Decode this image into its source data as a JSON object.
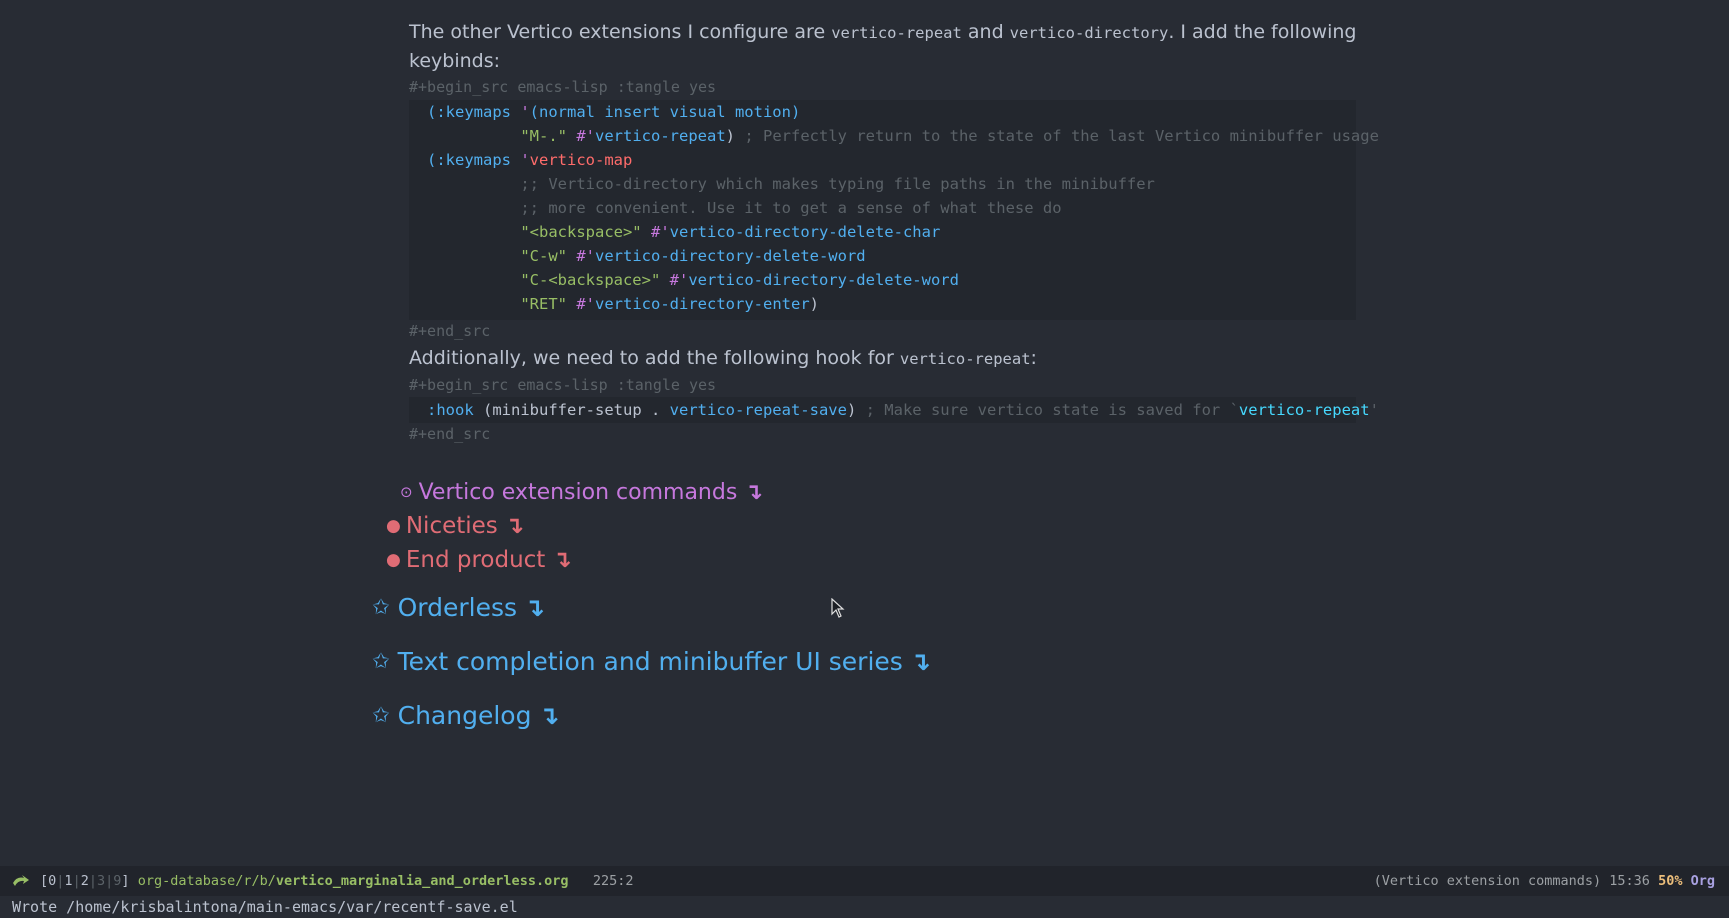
{
  "paragraph1": {
    "t1": "The other Vertico extensions I configure are ",
    "c1": "vertico-repeat",
    "t2": " and ",
    "c2": "vertico-directory",
    "t3": ". I add the following",
    "line2": "keybinds:"
  },
  "src1": {
    "begin": "#+begin_src emacs-lisp :tangle yes",
    "end": "#+end_src",
    "lines": [
      {
        "a": "(:keymaps ",
        "b": "'",
        "c": "(normal insert visual motion)"
      },
      {
        "indent": "          ",
        "str": "\"M-.\"",
        "sp": " ",
        "q": "#'",
        "fn": "vertico-repeat",
        "close": ")",
        "cmt": " ; Perfectly return to the state of the last Vertico minibuffer usage"
      },
      {
        "a": "(:keymaps ",
        "b": "'",
        "sym": "vertico-map"
      },
      {
        "indent": "          ",
        "cmt": ";; Vertico-directory which makes typing file paths in the minibuffer"
      },
      {
        "indent": "          ",
        "cmt": ";; more convenient. Use it to get a sense of what these do"
      },
      {
        "indent": "          ",
        "str": "\"<backspace>\"",
        "sp": " ",
        "q": "#'",
        "fn": "vertico-directory-delete-char"
      },
      {
        "indent": "          ",
        "str": "\"C-w\"",
        "sp": " ",
        "q": "#'",
        "fn": "vertico-directory-delete-word"
      },
      {
        "indent": "          ",
        "str": "\"C-<backspace>\"",
        "sp": " ",
        "q": "#'",
        "fn": "vertico-directory-delete-word"
      },
      {
        "indent": "          ",
        "str": "\"RET\"",
        "sp": " ",
        "q": "#'",
        "fn": "vertico-directory-enter",
        "close": ")"
      }
    ]
  },
  "paragraph2": {
    "t1": "Additionally, we need to add the following hook for ",
    "c1": "vertico-repeat",
    "t2": ":"
  },
  "src2": {
    "begin": "#+begin_src emacs-lisp :tangle yes",
    "end": "#+end_src",
    "hook_kw": ":hook",
    "open": " (",
    "arg1": "minibuffer-setup",
    "dot": " . ",
    "arg2": "vertico-repeat-save",
    "close": ")",
    "cmt1": " ; Make sure vertico state is saved for `",
    "cmt_ref": "vertico-repeat",
    "cmt2": "'"
  },
  "headings": {
    "h_ext": {
      "bullet": "⊙",
      "title": "Vertico extension commands",
      "fold": "↴"
    },
    "h_niceties": {
      "bullet": "●",
      "title": "Niceties",
      "fold": "↴"
    },
    "h_end": {
      "bullet": "●",
      "title": "End product",
      "fold": "↴"
    },
    "h_orderless": {
      "bullet": "✩",
      "title": "Orderless",
      "fold": "↴"
    },
    "h_series": {
      "bullet": "✩",
      "title": "Text completion and minibuffer UI series",
      "fold": "↴"
    },
    "h_changelog": {
      "bullet": "✩",
      "title": "Changelog",
      "fold": "↴"
    }
  },
  "modeline": {
    "icon": "evil-state-icon",
    "ws_open": "[",
    "ws0": "0",
    "ws1": "1",
    "ws2": "2",
    "ws3": "3",
    "ws9": "9",
    "ws_close": "]",
    "sep": "|",
    "path_dir": "org-database/r/b/",
    "path_file": "vertico_marginalia_and_orderless.org",
    "position": "225:2",
    "heading_ctx": "(Vertico extension commands)",
    "time": "15:36",
    "percent": "50%",
    "mode": "Org"
  },
  "echo": "Wrote /home/krisbalintona/main-emacs/var/recentf-save.el",
  "colors": {
    "background": "#282c34",
    "foreground": "#bbc2cf",
    "heading2": "#51afef",
    "heading3": "#c678dd",
    "heading4": "#e06c75"
  }
}
